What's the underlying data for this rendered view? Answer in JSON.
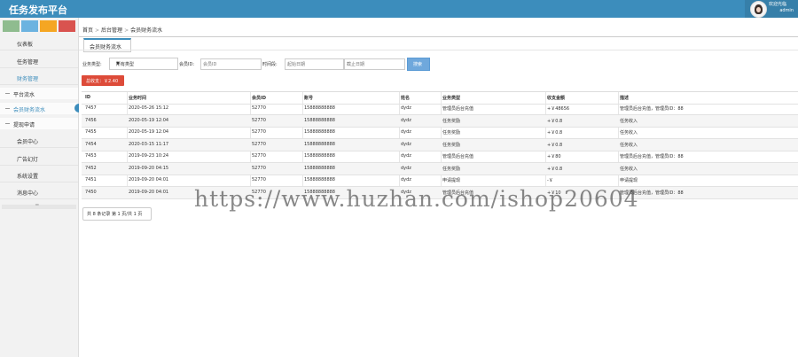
{
  "app": {
    "title": "任务发布平台"
  },
  "user": {
    "welcome": "欢迎光临",
    "name": "admin"
  },
  "theme": {
    "swatches": [
      "#8fbc8f",
      "#6cb3e0",
      "#f5a623",
      "#d9534f"
    ],
    "accent": "#3c8dbc"
  },
  "sidebar": {
    "items": [
      {
        "label": "仪表板"
      },
      {
        "label": "任务管理"
      },
      {
        "label": "财务管理"
      },
      {
        "label": "会员中心"
      },
      {
        "label": "广告幻灯"
      },
      {
        "label": "系统设置"
      },
      {
        "label": "消息中心"
      }
    ],
    "subitems": [
      {
        "label": "平台流水"
      },
      {
        "label": "会员财务流水"
      },
      {
        "label": "提现申请"
      }
    ]
  },
  "breadcrumb": {
    "home": "首页",
    "sep": ">",
    "level2": "后台管理",
    "level3": "会员财务流水"
  },
  "tab": {
    "label": "会员财务流水"
  },
  "filters": {
    "type_label": "业务类型:",
    "type_value": "所有类型",
    "member_label": "会员ID:",
    "member_placeholder": "会员ID",
    "time_label": "时间段:",
    "start_placeholder": "起始日期",
    "end_placeholder": "截止日期",
    "search_label": "搜索"
  },
  "total": {
    "label": "总收支：￥2.40"
  },
  "table": {
    "headers": [
      "ID",
      "业务时间",
      "会员ID",
      "账号",
      "姓名",
      "业务类型",
      "收支金额",
      "描述"
    ],
    "rows": [
      [
        "7457",
        "2020-05-26 15:12",
        "52770",
        "15888888888",
        "dydz",
        "管理员后台充值",
        "+￥48656",
        "管理员后台充值，管理员ID：88"
      ],
      [
        "7456",
        "2020-05-19 12:04",
        "52770",
        "15888888888",
        "dydz",
        "任务奖励",
        "+￥0.8",
        "任务收入"
      ],
      [
        "7455",
        "2020-05-19 12:04",
        "52770",
        "15888888888",
        "dydz",
        "任务奖励",
        "+￥0.8",
        "任务收入"
      ],
      [
        "7454",
        "2020-03-15 11:17",
        "52770",
        "15888888888",
        "dydz",
        "任务奖励",
        "+￥0.8",
        "任务收入"
      ],
      [
        "7453",
        "2019-09-23 10:24",
        "52770",
        "15888888888",
        "dydz",
        "管理员后台充值",
        "+￥80",
        "管理员后台充值，管理员ID：88"
      ],
      [
        "7452",
        "2019-09-20 04:15",
        "52770",
        "15888888888",
        "dydz",
        "任务奖励",
        "+￥0.8",
        "任务收入"
      ],
      [
        "7451",
        "2019-09-20 04:01",
        "52770",
        "15888888888",
        "dydz",
        "申请提现",
        "-￥",
        "申请提现"
      ],
      [
        "7450",
        "2019-09-20 04:01",
        "52770",
        "15888888888",
        "dydz",
        "管理员后台充值",
        "+￥10",
        "管理员后台充值，管理员ID：88"
      ]
    ]
  },
  "pager": {
    "label": "共 8 条记录 第 1 页/共 1 页"
  },
  "watermark": "https://www.huzhan.com/ishop20604"
}
